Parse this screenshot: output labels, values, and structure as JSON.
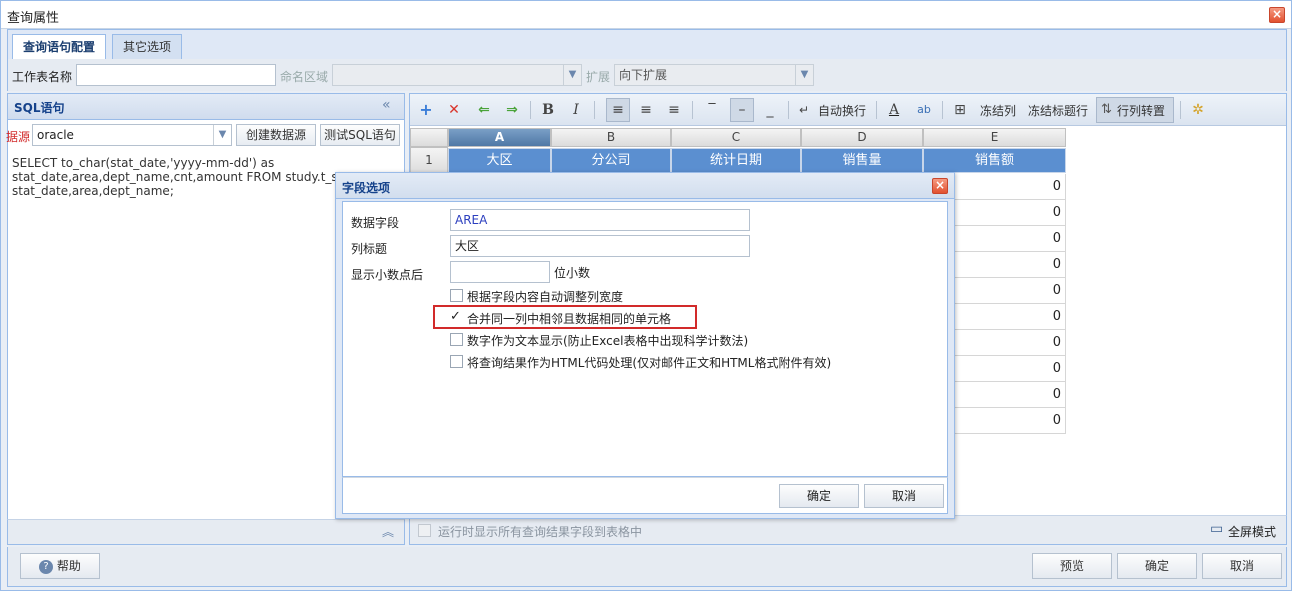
{
  "window": {
    "title": "查询属性"
  },
  "tabs": [
    {
      "label": "查询语句配置"
    },
    {
      "label": "其它选项"
    }
  ],
  "form": {
    "sheet_name_label": "工作表名称",
    "sheet_name_value": "",
    "named_range_label": "命名区域",
    "named_range_value": "",
    "expand_label": "扩展",
    "expand_value": "向下扩展"
  },
  "sql_panel": {
    "title": "SQL语句",
    "datasource_label": "据源",
    "datasource_value": "oracle",
    "create_datasource_button": "创建数据源",
    "test_sql_button": "测试SQL语句",
    "sql_text": "SELECT to_char(stat_date,'yyyy-mm-dd') as\nstat_date,area,dept_name,cnt,amount FROM study.t_stat OR\nstat_date,area,dept_name;"
  },
  "toolbar": {
    "wrap_text": "自动换行",
    "freeze_col": "冻结列",
    "freeze_title_row": "冻结标题行",
    "transpose": "行列转置"
  },
  "grid": {
    "columns": [
      "A",
      "B",
      "C",
      "D",
      "E"
    ],
    "row_numbers": [
      "1"
    ],
    "headers": [
      "大区",
      "分公司",
      "统计日期",
      "销售量",
      "销售额"
    ],
    "values": [
      "0",
      "0",
      "0",
      "0",
      "0",
      "0",
      "0",
      "0",
      "0",
      "0"
    ]
  },
  "footer": {
    "show_all_fields": "运行时显示所有查询结果字段到表格中",
    "fullscreen": "全屏模式"
  },
  "bottom": {
    "help": "帮助",
    "preview": "预览",
    "ok": "确定",
    "cancel": "取消"
  },
  "dialog": {
    "title": "字段选项",
    "data_field_label": "数据字段",
    "data_field_value": "AREA",
    "column_title_label": "列标题",
    "column_title_value": "大区",
    "decimal_label": "显示小数点后",
    "decimal_value": "",
    "decimal_suffix": "位小数",
    "options": [
      {
        "label": "根据字段内容自动调整列宽度",
        "checked": false
      },
      {
        "label": "合并同一列中相邻且数据相同的单元格",
        "checked": true
      },
      {
        "label": "数字作为文本显示(防止Excel表格中出现科学计数法)",
        "checked": false
      },
      {
        "label": "将查询结果作为HTML代码处理(仅对邮件正文和HTML格式附件有效)",
        "checked": false
      }
    ],
    "ok": "确定",
    "cancel": "取消"
  }
}
